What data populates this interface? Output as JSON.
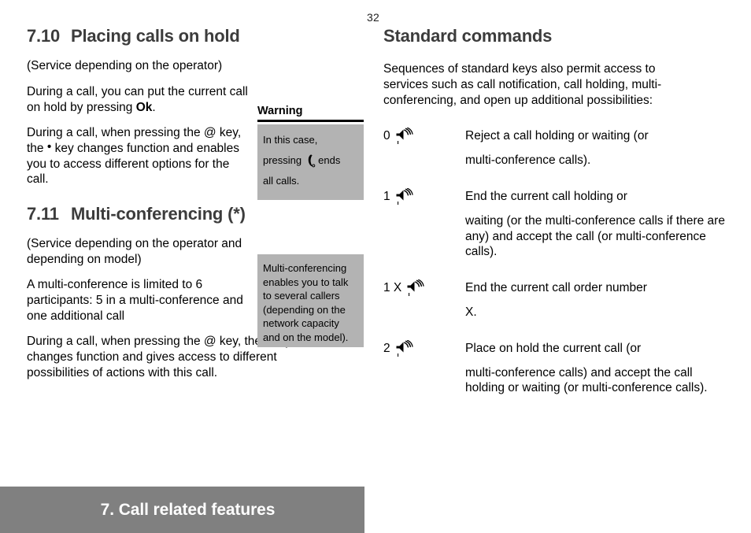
{
  "page": {
    "number": "32"
  },
  "left_column": {
    "section_710": {
      "number": "7.10",
      "title": "Placing calls on hold",
      "paragraphs": [
        "(Service depending on the operator)",
        "During a call, you can put the current call on hold by pressing ",
        "During a call, when pressing the @ key, the ",
        " key changes function and enables you to access different options for the call."
      ],
      "bold_key": "Ok",
      "bold_key_suffix": ".",
      "bullet_symbol": "•"
    },
    "section_711": {
      "number": "7.11",
      "title": "Multi-conferencing (*)",
      "paragraph_1": "(Service depending on the operator and depending on model)",
      "paragraph_2": "A multi-conference is limited to 6 participants: 5 in a multi-conference and one additional call",
      "paragraph_3_part1": "During a call, when pressing the @ key, the ",
      "paragraph_3_part2": " key changes function and gives access to different possibilities of actions with this call.",
      "bullet_symbol": "•"
    },
    "callout_warning": {
      "label": "Warning",
      "line_1": "In this case,",
      "line_2_before": "pressing",
      "icon": "phone-handset-icon",
      "line_2_after": "ends",
      "line_3": "all calls."
    },
    "callout_multi": {
      "text": "Multi-conferencing enables you to talk to several callers (depending on the network capacity and on the model)."
    }
  },
  "right_column": {
    "heading": "Standard commands",
    "intro": "Sequences of standard keys also permit access to services such as call notification, call holding, multi-conferencing, and open up additional possibilities:",
    "commands": [
      {
        "key": "0",
        "icon": "send-key-speaker-icon",
        "desc_first_line": "Reject a call holding or waiting (or",
        "desc_rest": "multi-conference calls)."
      },
      {
        "key": "1",
        "icon": "send-key-speaker-icon",
        "desc_first_line": "End the current call holding or",
        "desc_rest": "waiting (or the multi-conference calls if there are any) and accept the call (or multi-conference calls)."
      },
      {
        "key": "1 X",
        "icon": "send-key-speaker-icon",
        "desc_first_line": "End the current call order number",
        "desc_rest": "X."
      },
      {
        "key": "2",
        "icon": "send-key-speaker-icon",
        "desc_first_line": "Place on hold the current call (or",
        "desc_rest": "multi-conference calls) and accept the call holding or waiting (or multi-conference calls)."
      }
    ]
  },
  "footer": {
    "title": "7. Call related features",
    "background_color": "#808080",
    "text_color": "#ffffff"
  },
  "colors": {
    "heading": "#3c3c3c",
    "callout_background": "#b3b3b3",
    "body_text": "#000000"
  }
}
